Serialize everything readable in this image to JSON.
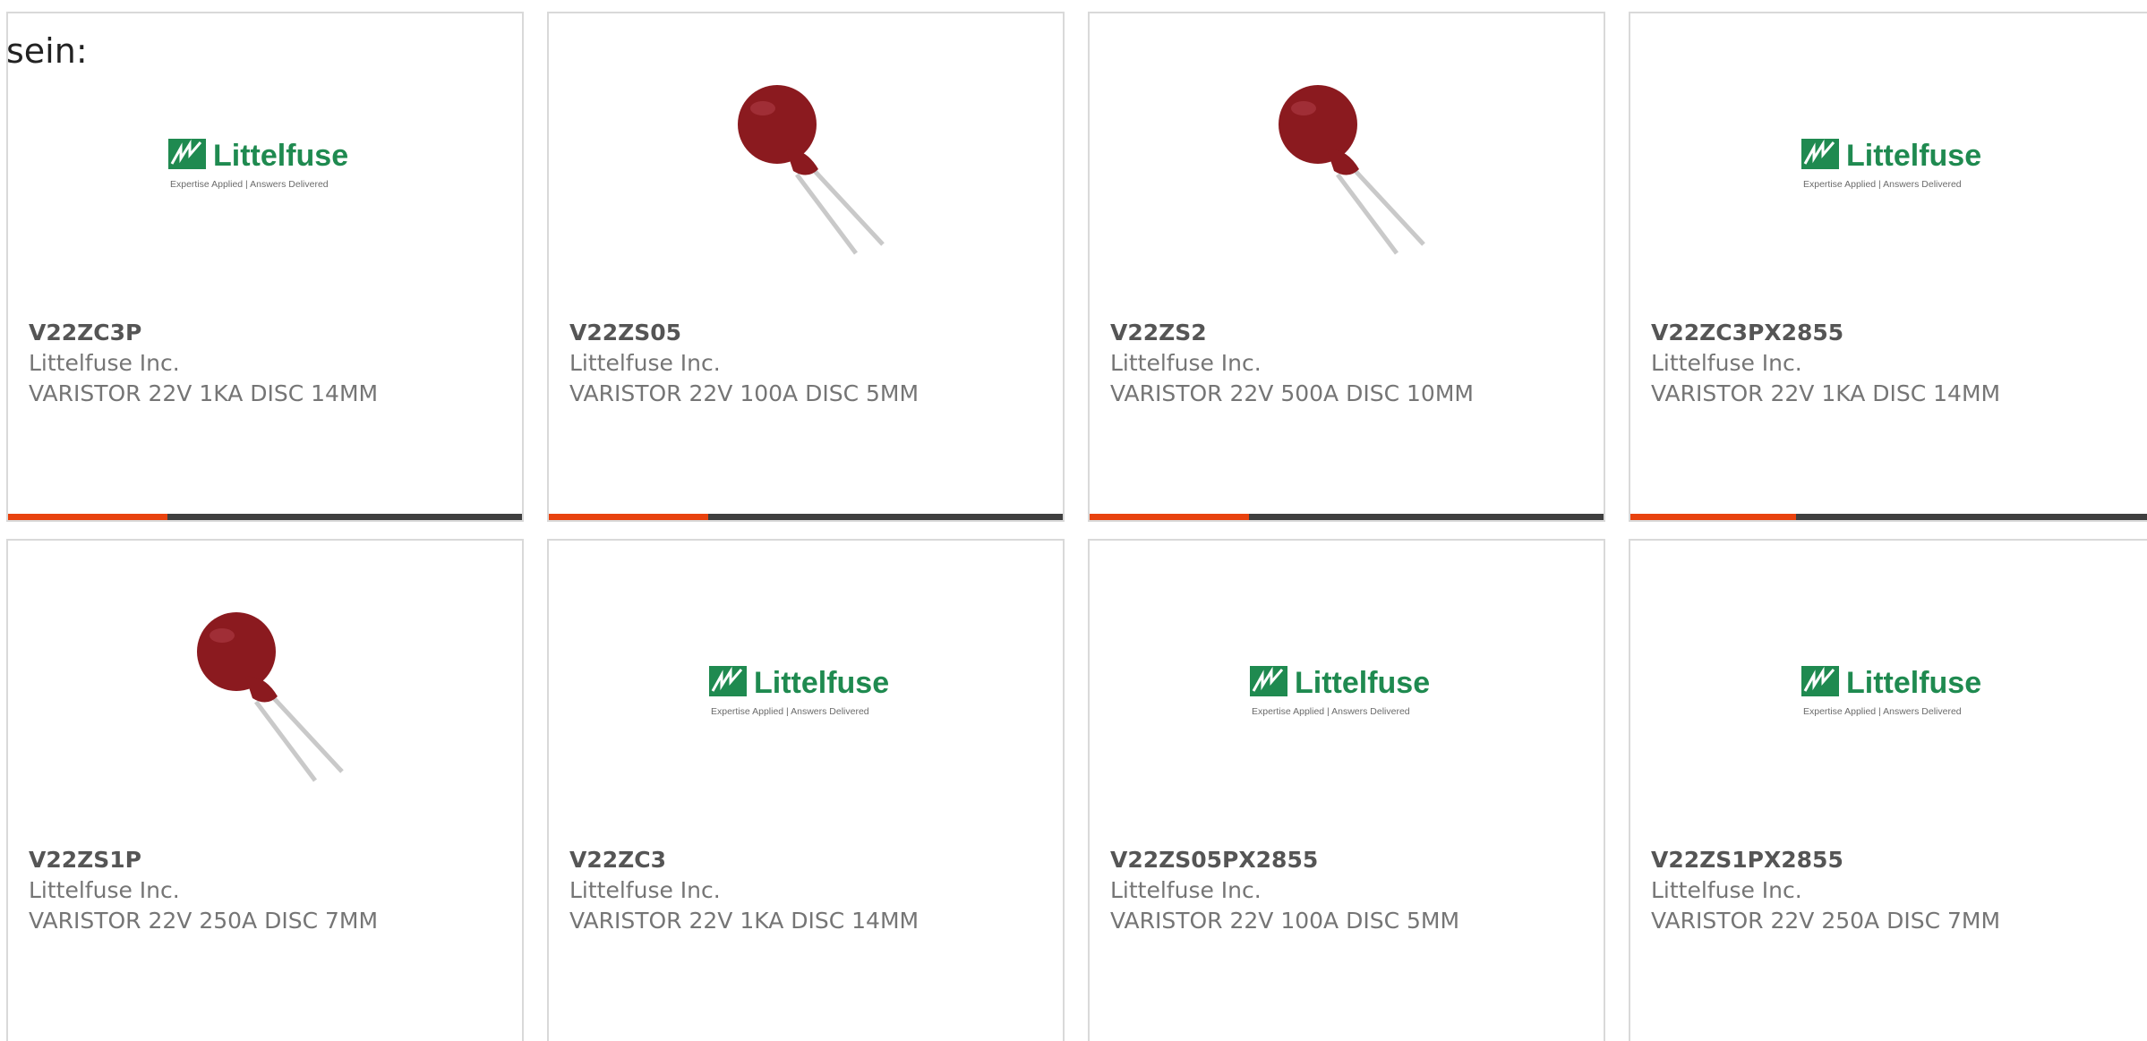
{
  "intro_text": "sein:",
  "colors": {
    "accent": "#e8420e",
    "bar": "#3f3f3f",
    "logo_green": "#1f8a50",
    "varistor_red": "#8b1a1f"
  },
  "cards": [
    {
      "part": "V22ZC3P",
      "maker": "Littelfuse Inc.",
      "desc": "VARISTOR 22V 1KA DISC 14MM",
      "image": "logo",
      "logo": {
        "name": "Littelfuse",
        "tagline": "Expertise Applied | Answers Delivered"
      },
      "progress": 0.31
    },
    {
      "part": "V22ZS05",
      "maker": "Littelfuse Inc.",
      "desc": "VARISTOR 22V 100A DISC 5MM",
      "image": "varistor",
      "progress": 0.31
    },
    {
      "part": "V22ZS2",
      "maker": "Littelfuse Inc.",
      "desc": "VARISTOR 22V 500A DISC 10MM",
      "image": "varistor",
      "progress": 0.31
    },
    {
      "part": "V22ZC3PX2855",
      "maker": "Littelfuse Inc.",
      "desc": "VARISTOR 22V 1KA DISC 14MM",
      "image": "logo",
      "logo": {
        "name": "Littelfuse",
        "tagline": "Expertise Applied | Answers Delivered"
      },
      "progress": 0.31
    },
    {
      "part": "V22ZS1P",
      "maker": "Littelfuse Inc.",
      "desc": "VARISTOR 22V 250A DISC 7MM",
      "image": "varistor"
    },
    {
      "part": "V22ZC3",
      "maker": "Littelfuse Inc.",
      "desc": "VARISTOR 22V 1KA DISC 14MM",
      "image": "logo",
      "logo": {
        "name": "Littelfuse",
        "tagline": "Expertise Applied | Answers Delivered"
      }
    },
    {
      "part": "V22ZS05PX2855",
      "maker": "Littelfuse Inc.",
      "desc": "VARISTOR 22V 100A DISC 5MM",
      "image": "logo",
      "logo": {
        "name": "Littelfuse",
        "tagline": "Expertise Applied | Answers Delivered"
      }
    },
    {
      "part": "V22ZS1PX2855",
      "maker": "Littelfuse Inc.",
      "desc": "VARISTOR 22V 250A DISC 7MM",
      "image": "logo",
      "logo": {
        "name": "Littelfuse",
        "tagline": "Expertise Applied | Answers Delivered"
      }
    }
  ]
}
